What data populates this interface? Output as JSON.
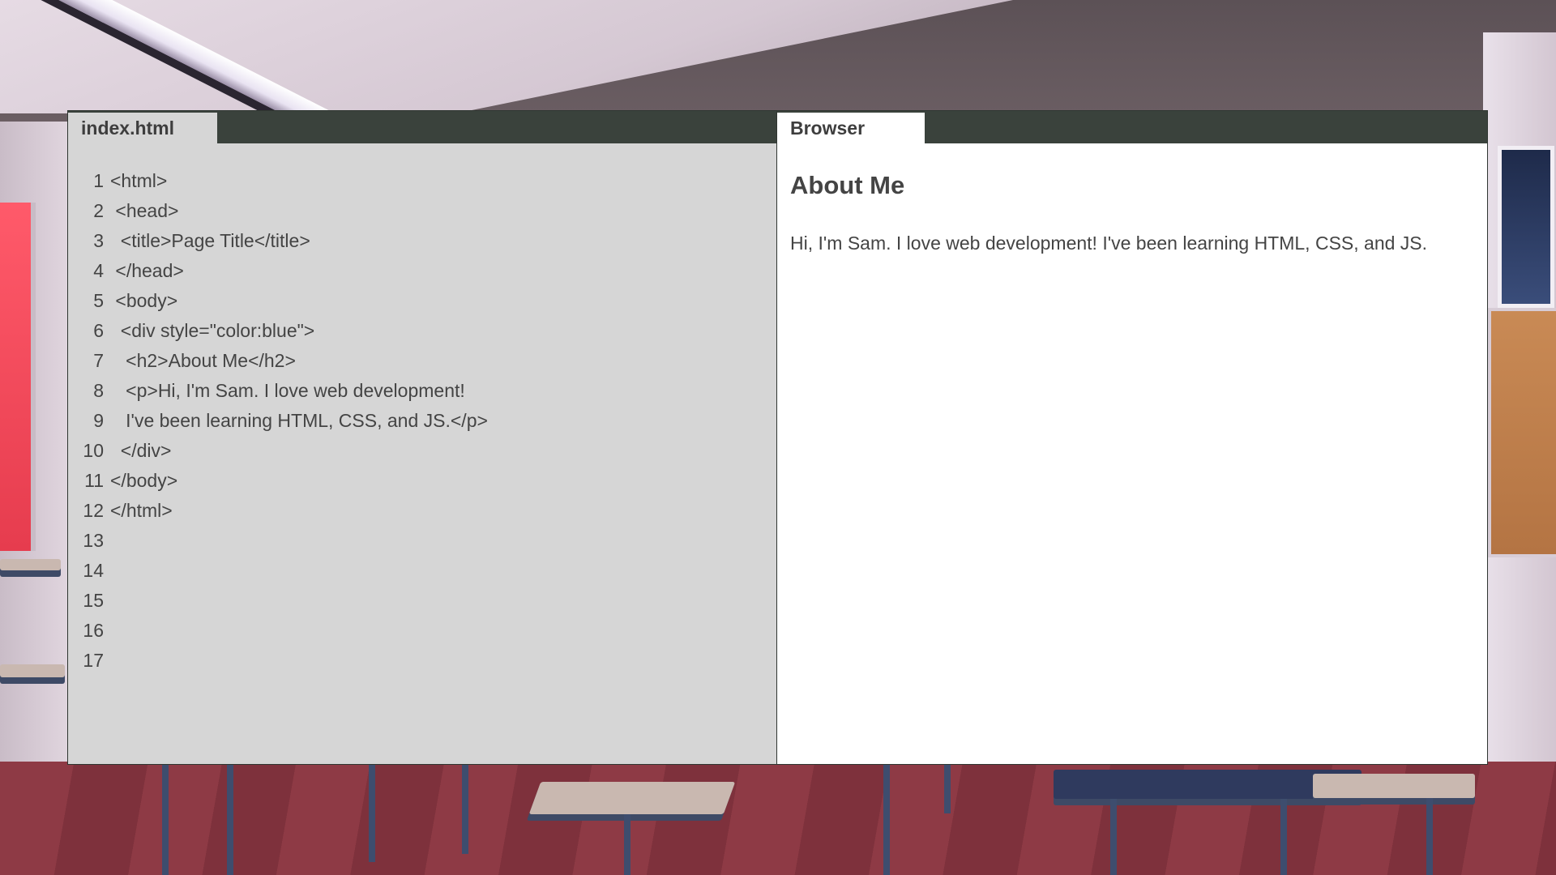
{
  "editor": {
    "tab_label": "index.html",
    "lines": [
      {
        "n": "1",
        "code": "<html>"
      },
      {
        "n": "2",
        "code": " <head>"
      },
      {
        "n": "3",
        "code": "  <title>Page Title</title>"
      },
      {
        "n": "4",
        "code": " </head>"
      },
      {
        "n": "5",
        "code": " <body>"
      },
      {
        "n": "6",
        "code": "  <div style=\"color:blue\">"
      },
      {
        "n": "7",
        "code": "   <h2>About Me</h2>"
      },
      {
        "n": "8",
        "code": "   <p>Hi, I'm Sam. I love web development!"
      },
      {
        "n": "9",
        "code": "   I've been learning HTML, CSS, and JS.</p>"
      },
      {
        "n": "10",
        "code": "  </div>"
      },
      {
        "n": "11",
        "code": "</body>"
      },
      {
        "n": "12",
        "code": "</html>"
      },
      {
        "n": "13",
        "code": ""
      },
      {
        "n": "14",
        "code": ""
      },
      {
        "n": "15",
        "code": ""
      },
      {
        "n": "16",
        "code": ""
      },
      {
        "n": "17",
        "code": ""
      }
    ]
  },
  "browser": {
    "tab_label": "Browser",
    "heading": "About Me",
    "paragraph": "Hi, I'm Sam. I love web development! I've been learning HTML, CSS, and JS."
  },
  "colors": {
    "tab_bar": "#3a423c",
    "editor_bg": "#d6d6d6",
    "browser_bg": "#ffffff",
    "text": "#444444"
  }
}
